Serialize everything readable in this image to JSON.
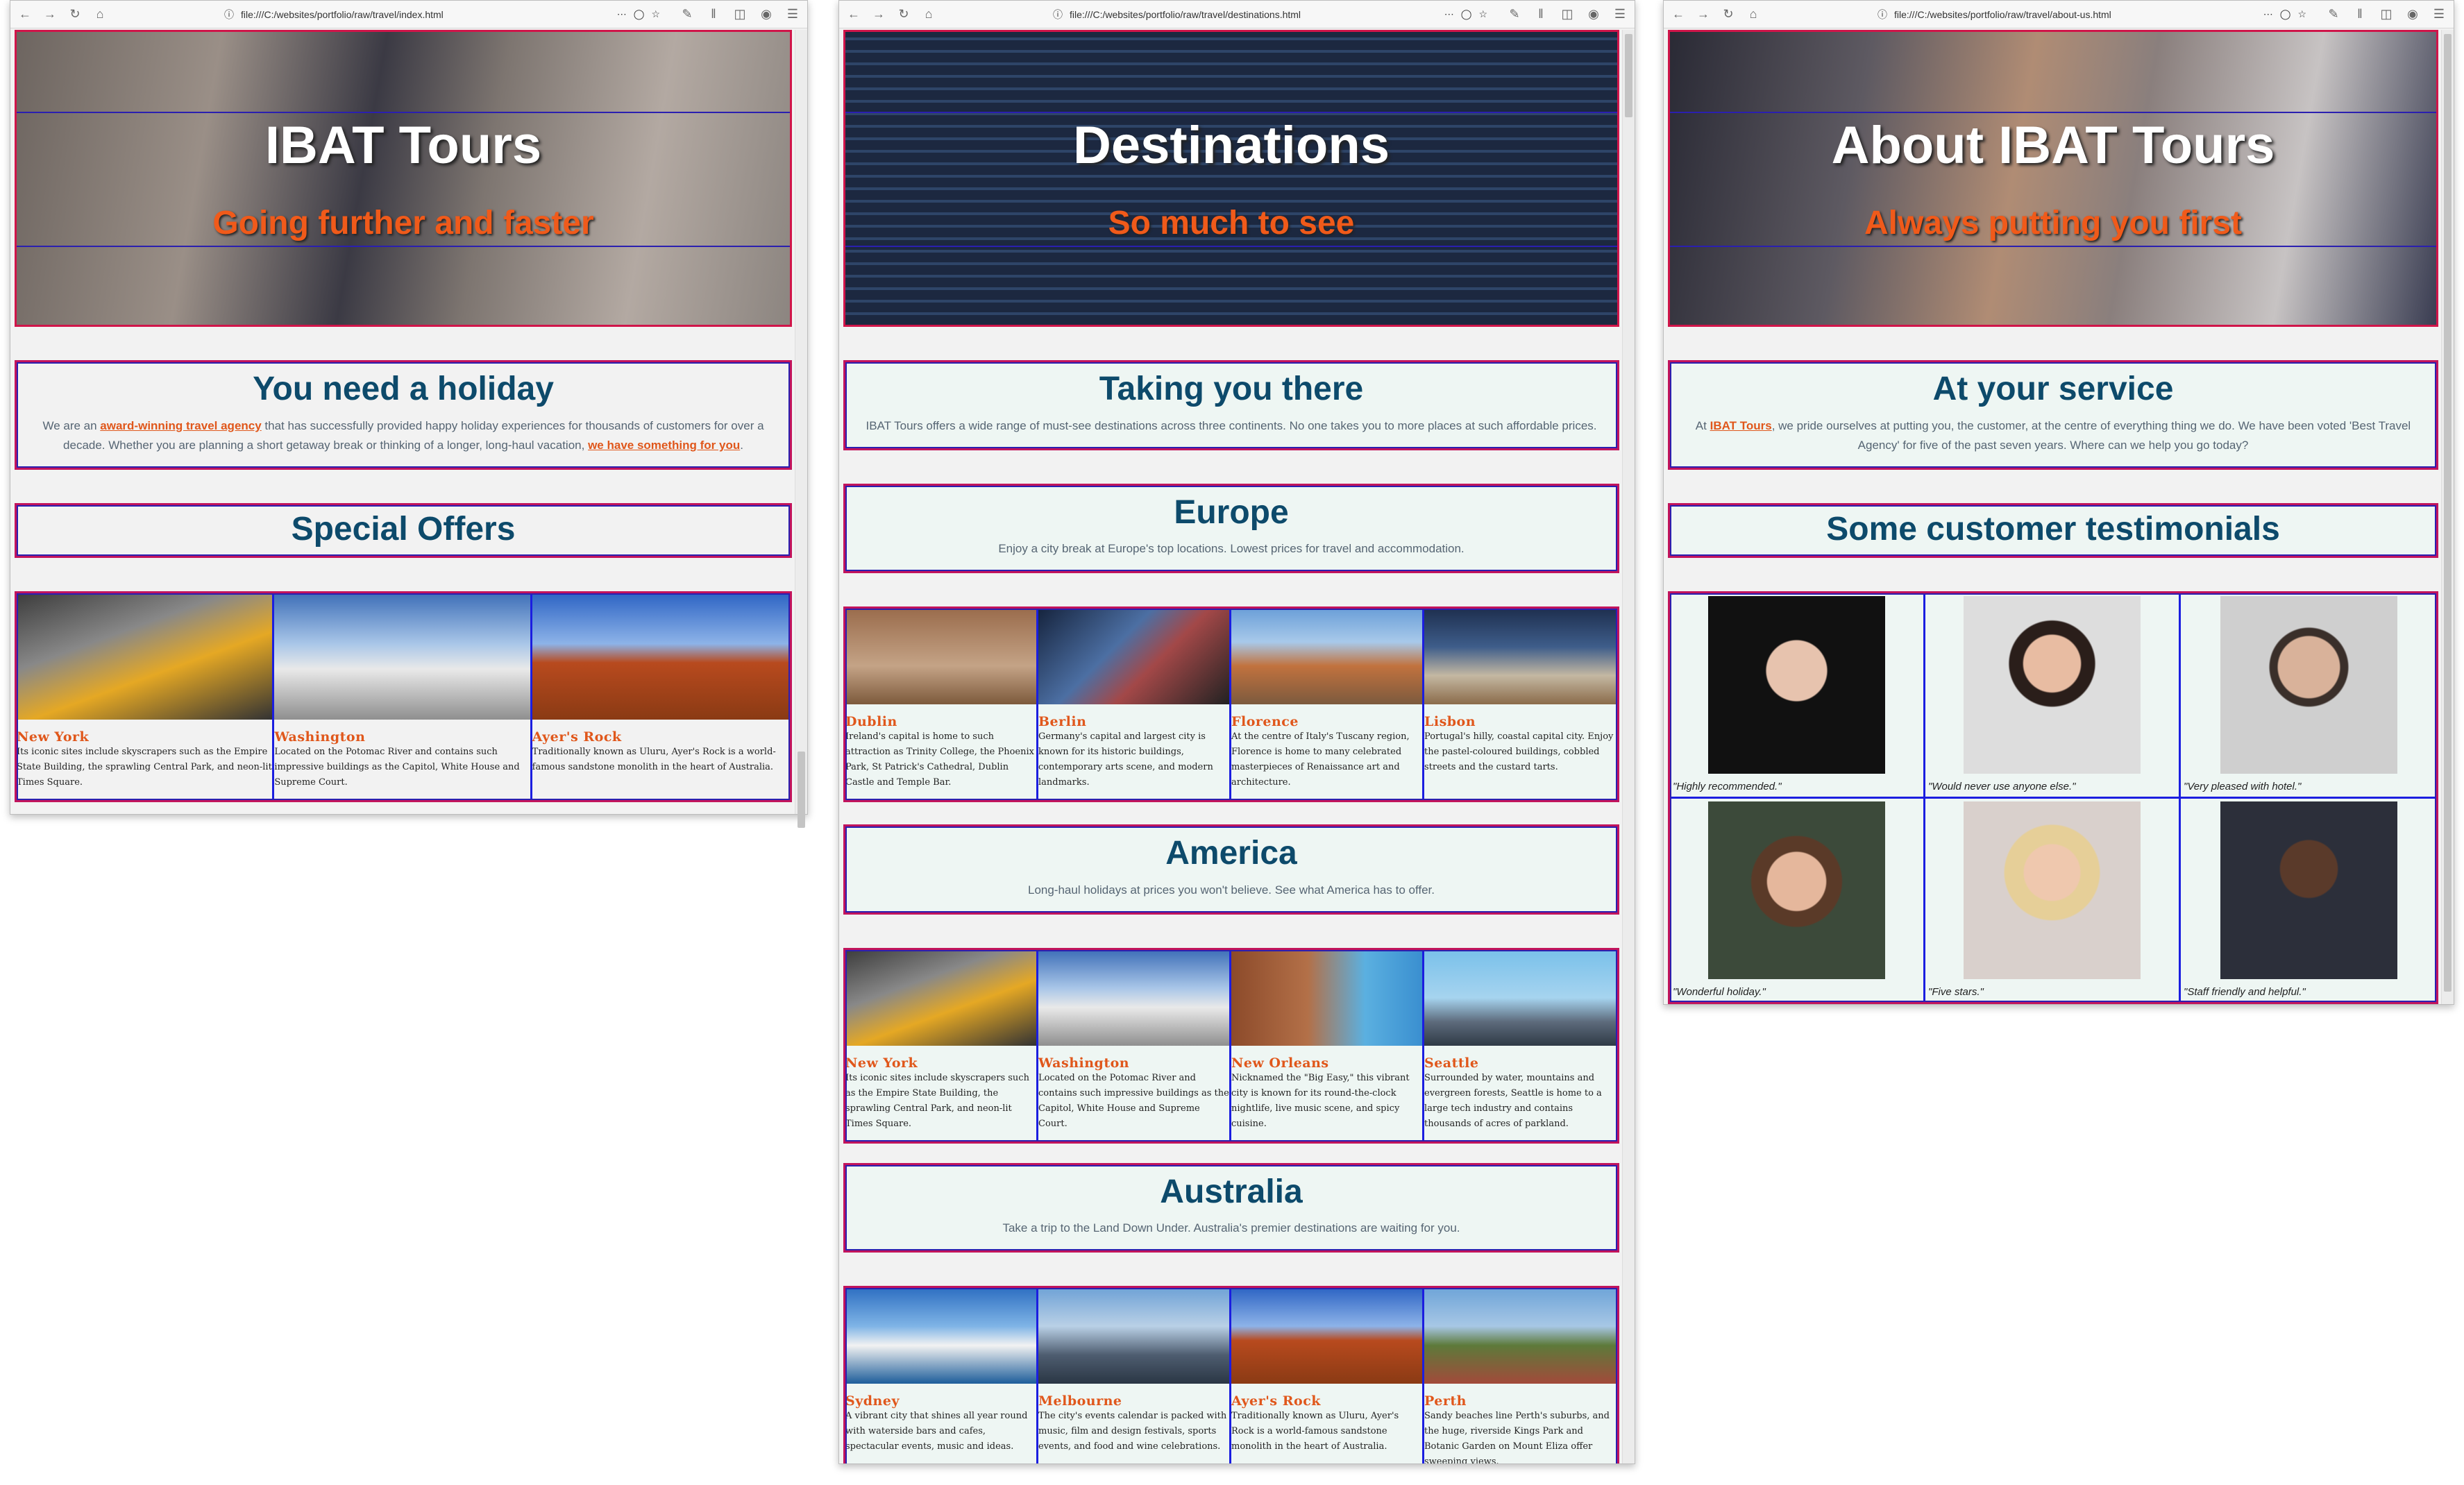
{
  "windows": [
    {
      "url": "file:///C:/websites/portfolio/raw/travel/index.html",
      "hero": {
        "title": "IBAT Tours",
        "subtitle": "Going further and faster"
      },
      "intro": {
        "heading": "You need a holiday",
        "text_1": "We are an ",
        "link_1": "award-winning travel agency",
        "text_2": " that has successfully provided happy holiday experiences for thousands of customers for over a decade. Whether you are planning a short getaway break or thinking of a longer, long-haul vacation, ",
        "link_2": "we have something for you",
        "text_3": "."
      },
      "offers_heading": "Special Offers",
      "offers": [
        {
          "name": "New York",
          "desc": "Its iconic sites include skyscrapers such as the Empire State Building, the sprawling Central Park, and neon-lit Times Square."
        },
        {
          "name": "Washington",
          "desc": "Located on the Potomac River and contains such impressive buildings as the Capitol, White House and Supreme Court."
        },
        {
          "name": "Ayer's Rock",
          "desc": "Traditionally known as Uluru, Ayer's Rock is a world-famous sandstone monolith in the heart of Australia."
        }
      ]
    },
    {
      "url": "file:///C:/websites/portfolio/raw/travel/destinations.html",
      "hero": {
        "title": "Destinations",
        "subtitle": "So much to see"
      },
      "intro": {
        "heading": "Taking you there",
        "text": "IBAT Tours offers a wide range of must-see destinations across three continents. No one takes you to more places at such affordable prices."
      },
      "regions": [
        {
          "heading": "Europe",
          "text": "Enjoy a city break at Europe's top locations. Lowest prices for travel and accommodation.",
          "cities": [
            {
              "name": "Dublin",
              "desc": "Ireland's capital is home to such attraction as Trinity College, the Phoenix Park, St Patrick's Cathedral, Dublin Castle and Temple Bar."
            },
            {
              "name": "Berlin",
              "desc": "Germany's capital and largest city is known for its historic buildings, contemporary arts scene, and modern landmarks."
            },
            {
              "name": "Florence",
              "desc": "At the centre of Italy's Tuscany region, Florence is home to many celebrated masterpieces of Renaissance art and architecture."
            },
            {
              "name": "Lisbon",
              "desc": "Portugal's hilly, coastal capital city. Enjoy the pastel-coloured buildings, cobbled streets and the custard tarts."
            }
          ]
        },
        {
          "heading": "America",
          "text": "Long-haul holidays at prices you won't believe. See what America has to offer.",
          "cities": [
            {
              "name": "New York",
              "desc": "Its iconic sites include skyscrapers such as the Empire State Building, the sprawling Central Park, and neon-lit Times Square."
            },
            {
              "name": "Washington",
              "desc": "Located on the Potomac River and contains such impressive buildings as the Capitol, White House and Supreme Court."
            },
            {
              "name": "New Orleans",
              "desc": "Nicknamed the \"Big Easy,\" this vibrant city is known for its round-the-clock nightlife, live music scene, and spicy cuisine."
            },
            {
              "name": "Seattle",
              "desc": "Surrounded by water, mountains and evergreen forests, Seattle is home to a large tech industry and contains thousands of acres of parkland."
            }
          ]
        },
        {
          "heading": "Australia",
          "text": "Take a trip to the Land Down Under. Australia's premier destinations are waiting for you.",
          "cities": [
            {
              "name": "Sydney",
              "desc": "A vibrant city that shines all year round with waterside bars and cafes, spectacular events, music and ideas."
            },
            {
              "name": "Melbourne",
              "desc": "The city's events calendar is packed with music, film and design festivals, sports events, and food and wine celebrations."
            },
            {
              "name": "Ayer's Rock",
              "desc": "Traditionally known as Uluru, Ayer's Rock is a world-famous sandstone monolith in the heart of Australia."
            },
            {
              "name": "Perth",
              "desc": "Sandy beaches line Perth's suburbs, and the huge, riverside Kings Park and Botanic Garden on Mount Eliza offer sweeping views."
            }
          ]
        }
      ]
    },
    {
      "url": "file:///C:/websites/portfolio/raw/travel/about-us.html",
      "hero": {
        "title": "About IBAT Tours",
        "subtitle": "Always putting you first"
      },
      "intro": {
        "heading": "At your service",
        "text_1": "At ",
        "link_1": "IBAT Tours",
        "text_2": ", we pride ourselves at putting you, the customer, at the centre of everything thing we do. We have been voted 'Best Travel Agency' for five of the past seven years. Where can we help you go today?"
      },
      "testimonials_heading": "Some customer testimonials",
      "testimonials": [
        {
          "quote": "\"Highly recommended.\""
        },
        {
          "quote": "\"Would never use anyone else.\""
        },
        {
          "quote": "\"Very pleased with hotel.\""
        },
        {
          "quote": "\"Wonderful holiday.\""
        },
        {
          "quote": "\"Five stars.\""
        },
        {
          "quote": "\"Staff friendly and helpful.\""
        }
      ]
    }
  ],
  "toolbar_icons": [
    "back-icon",
    "forward-icon",
    "reload-icon",
    "home-icon",
    "info-icon",
    "more-icon",
    "pocket-icon",
    "bookmark-star-icon",
    "tools-icon",
    "library-icon",
    "sidebar-icon",
    "account-icon",
    "menu-icon"
  ],
  "colors": {
    "accent": "#e0571b",
    "heading": "#0d4a6b",
    "border_outer": "#c2145c",
    "border_inner": "#2a1fb0",
    "divider": "#1b1ee0"
  }
}
